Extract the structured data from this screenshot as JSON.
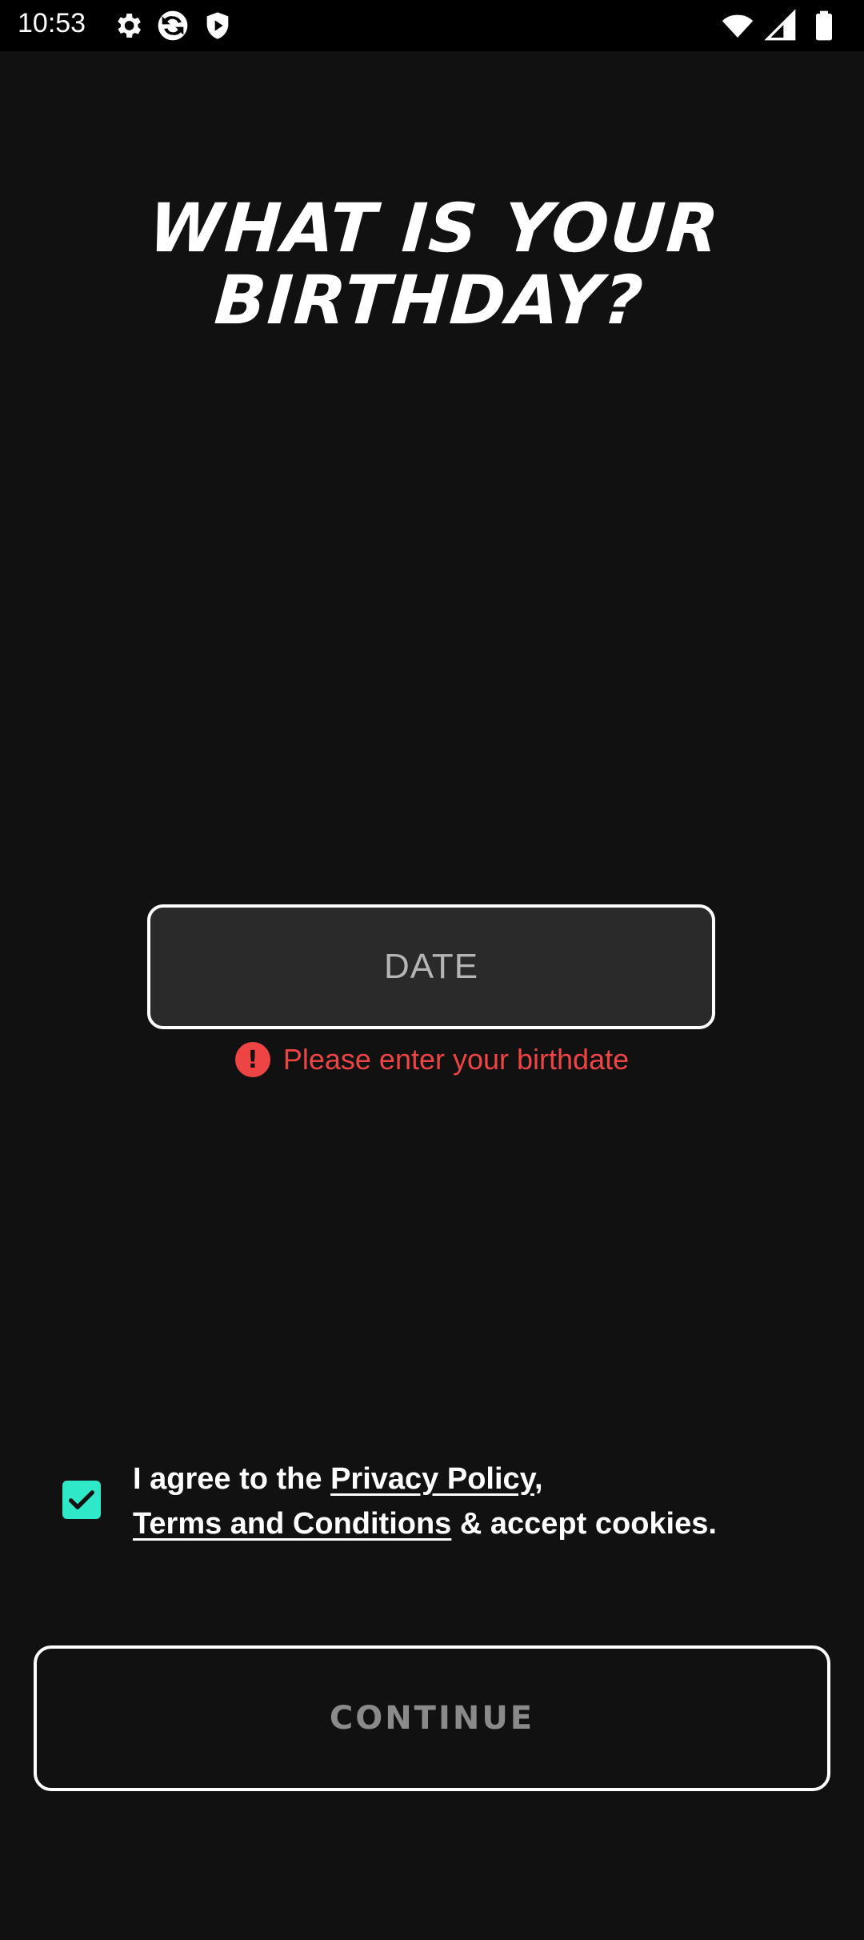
{
  "status_bar": {
    "time": "10:53",
    "left_icons": [
      "gear-icon",
      "sync-icon",
      "shield-icon"
    ],
    "right_icons": [
      "wifi-icon",
      "signal-icon",
      "battery-icon"
    ]
  },
  "title": {
    "line1": "WHAT IS YOUR",
    "line2": "BIRTHDAY?"
  },
  "date_field": {
    "placeholder": "DATE"
  },
  "error": {
    "icon": "exclamation-icon",
    "message": "Please enter your birthdate",
    "color": "#ee4444"
  },
  "consent": {
    "checked": true,
    "text_prefix": "I agree to the ",
    "privacy_link": "Privacy Policy",
    "comma": ",",
    "terms_link": "Terms and Conditions",
    "text_suffix": " & accept cookies.",
    "checkbox_color": "#2ee8c8"
  },
  "continue_button": {
    "label": "CONTINUE"
  }
}
